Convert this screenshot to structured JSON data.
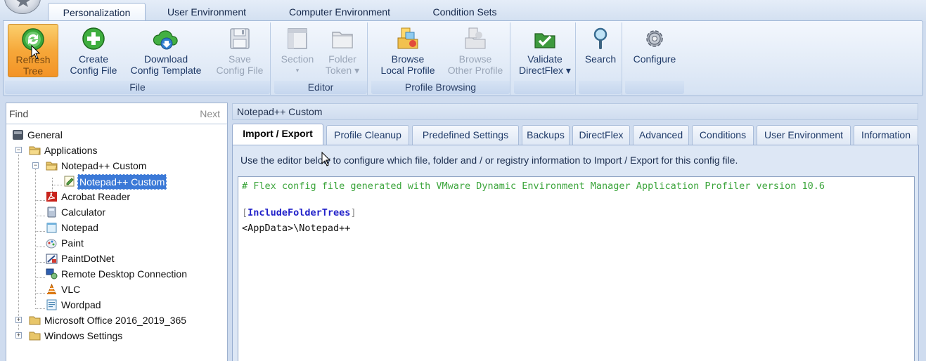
{
  "ribbon_tabs": [
    "Personalization",
    "User Environment",
    "Computer Environment",
    "Condition Sets"
  ],
  "ribbon": {
    "file_group": {
      "label": "File",
      "refresh_tree": [
        "Refresh",
        "Tree"
      ],
      "create_config": [
        "Create",
        "Config File"
      ],
      "download_template": [
        "Download",
        "Config Template"
      ],
      "save_config": [
        "Save",
        "Config File"
      ]
    },
    "editor_group": {
      "label": "Editor",
      "section": [
        "Section",
        "▾"
      ],
      "folder_token": [
        "Folder",
        "Token ▾"
      ]
    },
    "profile_group": {
      "label": "Profile Browsing",
      "browse_local": [
        "Browse",
        "Local Profile"
      ],
      "browse_other": [
        "Browse",
        "Other Profile"
      ]
    },
    "validate": [
      "Validate",
      "DirectFlex ▾"
    ],
    "search": [
      "Search"
    ],
    "configure": [
      "Configure"
    ]
  },
  "find": {
    "placeholder": "Find",
    "next_label": "Next"
  },
  "tree": {
    "general": "General",
    "applications": "Applications",
    "notepadpp_folder": "Notepad++ Custom",
    "notepadpp_file": "Notepad++ Custom",
    "acrobat": "Acrobat Reader",
    "calculator": "Calculator",
    "notepad": "Notepad",
    "paint": "Paint",
    "paintdotnet": "PaintDotNet",
    "rdc": "Remote Desktop Connection",
    "vlc": "VLC",
    "wordpad": "Wordpad",
    "office": "Microsoft Office 2016_2019_365",
    "windows_settings": "Windows Settings"
  },
  "right": {
    "header": "Notepad++ Custom",
    "tabs": [
      "Import / Export",
      "Profile Cleanup",
      "Predefined Settings",
      "Backups",
      "DirectFlex",
      "Advanced",
      "Conditions",
      "User Environment",
      "Information"
    ],
    "description": "Use the editor below to configure which file, folder and / or registry information to Import / Export for this config file.",
    "editor": {
      "comment": "# Flex config file generated with VMware Dynamic Environment Manager Application Profiler version 10.6",
      "open_bracket": "[",
      "section": "IncludeFolderTrees",
      "close_bracket": "]",
      "path": "<AppData>\\Notepad++"
    }
  }
}
